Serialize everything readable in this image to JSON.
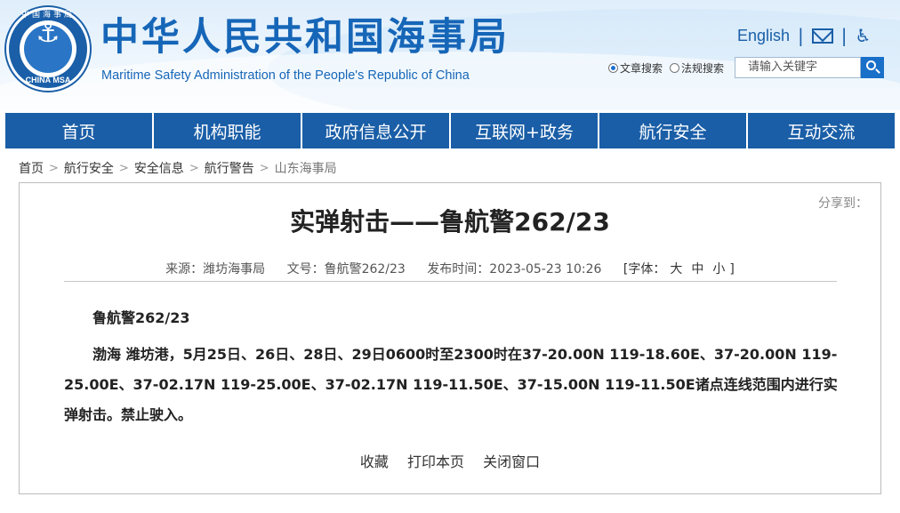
{
  "header": {
    "logo": {
      "top_text": "中国海事局",
      "bottom_text": "CHINA MSA"
    },
    "site_title": "中华人民共和国海事局",
    "site_subtitle": "Maritime Safety Administration of the People's Republic of China",
    "english_link": "English",
    "icons": [
      "mail-icon",
      "accessibility-icon"
    ],
    "search": {
      "options": [
        "文章搜索",
        "法规搜索"
      ],
      "selected_option": "文章搜索",
      "placeholder": "请输入关键字"
    }
  },
  "nav": {
    "items": [
      "首页",
      "机构职能",
      "政府信息公开",
      "互联网+政务",
      "航行安全",
      "互动交流"
    ]
  },
  "breadcrumb": {
    "items": [
      "首页",
      "航行安全",
      "安全信息",
      "航行警告",
      "山东海事局"
    ],
    "separator": ">"
  },
  "article": {
    "share_label": "分享到：",
    "title": "实弹射击——鲁航警262/23",
    "source": "来源：潍坊海事局",
    "doc_number": "文号：鲁航警262/23",
    "publish_time": "发布时间：2023-05-23 10:26",
    "font_size": {
      "label": "[字体：",
      "large": "大",
      "medium": "中",
      "small": "小",
      "close": "]"
    },
    "heading": "鲁航警262/23",
    "body": "渤海 潍坊港，5月25日、26日、28日、29日0600时至2300时在37-20.00N 119-18.60E、37-20.00N 119-25.00E、37-02.17N 119-25.00E、37-02.17N 119-11.50E、37-15.00N 119-11.50E诸点连线范围内进行实弹射击。禁止驶入。",
    "actions": {
      "favorite": "收藏",
      "print": "打印本页",
      "close": "关闭窗口"
    }
  },
  "colors": {
    "brand_blue": "#1666b8",
    "nav_blue": "#1a5ea7"
  }
}
